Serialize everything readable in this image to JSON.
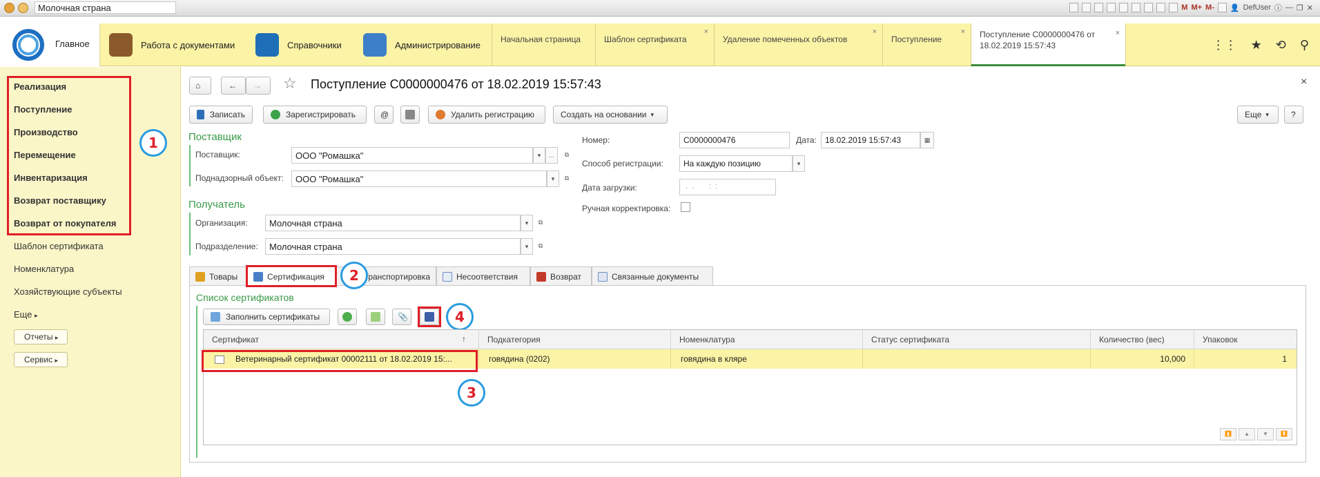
{
  "window": {
    "title": "Молочная страна",
    "user": "DefUser",
    "m_labels": [
      "M",
      "M+",
      "M-"
    ]
  },
  "main_menu": {
    "items": [
      {
        "label": "Главное"
      },
      {
        "label": "Работа с документами"
      },
      {
        "label": "Справочники"
      },
      {
        "label": "Администрирование"
      }
    ],
    "open_tabs": [
      {
        "label": "Начальная страница",
        "closable": false
      },
      {
        "label": "Шаблон сертификата",
        "closable": true
      },
      {
        "label": "Удаление помеченных объектов",
        "closable": true
      },
      {
        "label": "Поступление",
        "closable": true
      },
      {
        "label": "Поступление С0000000476 от 18.02.2019 15:57:43",
        "closable": true,
        "active": true
      }
    ]
  },
  "left_panel": {
    "bold_items": [
      "Реализация",
      "Поступление",
      "Производство",
      "Перемещение",
      "Инвентаризация",
      "Возврат поставщику",
      "Возврат от покупателя"
    ],
    "items": [
      "Шаблон сертификата",
      "Номенклатура",
      "Хозяйствующие субъекты"
    ],
    "more": "Еще",
    "buttons": [
      "Отчеты",
      "Сервис"
    ]
  },
  "annotations": [
    "1",
    "2",
    "3",
    "4"
  ],
  "document": {
    "title": "Поступление С0000000476 от 18.02.2019 15:57:43",
    "close_glyph": "×",
    "toolbar": {
      "save": "Записать",
      "register": "Зарегистрировать",
      "at": "@",
      "delete_registration": "Удалить регистрацию",
      "create_based": "Создать на основании",
      "more": "Еще",
      "help": "?"
    },
    "supplier_section": "Поставщик",
    "supplier_label": "Поставщик:",
    "supplier_value": "ООО \"Ромашка\"",
    "object_label": "Поднадзорный объект:",
    "object_value": "ООО \"Ромашка\"",
    "receiver_section": "Получатель",
    "org_label": "Организация:",
    "org_value": "Молочная страна",
    "dept_label": "Подразделение:",
    "dept_value": "Молочная страна",
    "number_label": "Номер:",
    "number_value": "С0000000476",
    "date_label": "Дата:",
    "date_value": "18.02.2019 15:57:43",
    "reg_method_label": "Способ регистрации:",
    "reg_method_value": "На каждую позицию",
    "load_date_label": "Дата загрузки:",
    "load_date_value": " .  .       :  :",
    "manual_label": "Ручная корректировка:",
    "tabs": [
      "Товары",
      "Сертификация",
      "Транспортировка",
      "Несоответствия",
      "Возврат",
      "Связанные документы"
    ],
    "cert_list_title": "Список сертификатов",
    "fill_button": "Заполнить сертификаты",
    "table": {
      "columns": [
        "Сертификат",
        "Подкатегория",
        "Номенклатура",
        "Статус сертификата",
        "Количество (вес)",
        "Упаковок"
      ],
      "sort_glyph": "↑",
      "rows": [
        {
          "certificate": "Ветеринарный сертификат 00002111 от 18.02.2019 15:...",
          "subcategory": "говядина (0202)",
          "nomenclature": "говядина в кляре",
          "status": "",
          "quantity": "10,000",
          "packages": "1"
        }
      ]
    }
  },
  "colors": {
    "menu_bg": "#fbf3a6",
    "panel_bg": "#fbf6c8",
    "accent_green": "#3a9a47",
    "annotation_red": "#e01e26",
    "annotation_blue": "#2a9be0"
  }
}
